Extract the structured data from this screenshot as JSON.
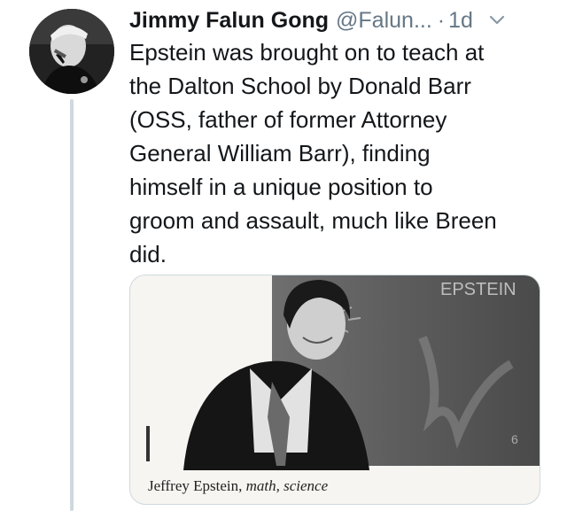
{
  "tweet": {
    "display_name": "Jimmy Falun Gong",
    "handle": "@Falun...",
    "separator": "·",
    "timestamp": "1d",
    "text": "Epstein was brought on to teach at\nthe Dalton School by Donald Barr\n(OSS, father of former Attorney\nGeneral William Barr), finding\nhimself in a unique position to\ngroom and assault, much like Breen\ndid.",
    "more_icon": "chevron-down-icon",
    "avatar_icon": "profile-photo"
  },
  "media": {
    "caption_name": "Jeffrey Epstein,",
    "caption_subjects": "math, science",
    "blackboard_text": "EPSTEIN"
  },
  "colors": {
    "text": "#14171a",
    "secondary": "#657786",
    "thread_line": "#cfd9de",
    "card_border": "#cfd9de"
  }
}
